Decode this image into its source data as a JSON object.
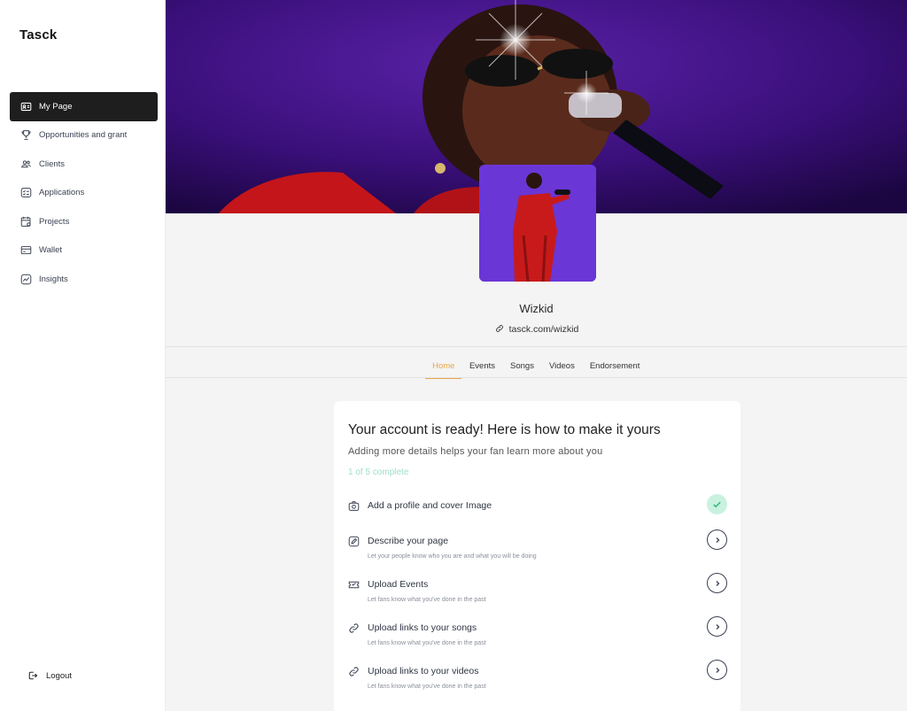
{
  "app": {
    "brand": "Tasck"
  },
  "sidebar": {
    "items": [
      {
        "label": "My Page",
        "icon": "id-card-icon",
        "active": true
      },
      {
        "label": "Opportunities and grant",
        "icon": "trophy-icon",
        "active": false
      },
      {
        "label": "Clients",
        "icon": "users-icon",
        "active": false
      },
      {
        "label": "Applications",
        "icon": "list-icon",
        "active": false
      },
      {
        "label": "Projects",
        "icon": "calendar-icon",
        "active": false
      },
      {
        "label": "Wallet",
        "icon": "wallet-icon",
        "active": false
      },
      {
        "label": "Insights",
        "icon": "chart-icon",
        "active": false
      }
    ],
    "logout_label": "Logout"
  },
  "profile": {
    "name": "Wizkid",
    "link": "tasck.com/wizkid"
  },
  "tabs": [
    {
      "label": "Home",
      "active": true
    },
    {
      "label": "Events",
      "active": false
    },
    {
      "label": "Songs",
      "active": false
    },
    {
      "label": "Videos",
      "active": false
    },
    {
      "label": "Endorsement",
      "active": false
    }
  ],
  "onboarding": {
    "title": "Your account is ready! Here is how to make it yours",
    "subtitle": "Adding more details helps your fan learn more about you",
    "progress_text": "1 of 5 complete",
    "tasks": [
      {
        "title": "Add a profile and cover Image",
        "description": "",
        "icon": "camera-icon",
        "done": true
      },
      {
        "title": "Describe your page",
        "description": "Let your people know who you are and what you will be doing",
        "icon": "edit-icon",
        "done": false
      },
      {
        "title": "Upload Events",
        "description": "Let fans know what you've done in the past",
        "icon": "ticket-icon",
        "done": false
      },
      {
        "title": "Upload links to your songs",
        "description": "Let fans know what you've done in the past",
        "icon": "link-icon",
        "done": false
      },
      {
        "title": "Upload links to your videos",
        "description": "Let fans know what you've done in the past",
        "icon": "link-icon",
        "done": false
      }
    ]
  },
  "colors": {
    "accent": "#e9a54c",
    "success": "#9fe0c4",
    "banner_purple": "#3a0f7a",
    "avatar_purple": "#6a36d6",
    "sidebar_active": "#1e1e1e"
  }
}
